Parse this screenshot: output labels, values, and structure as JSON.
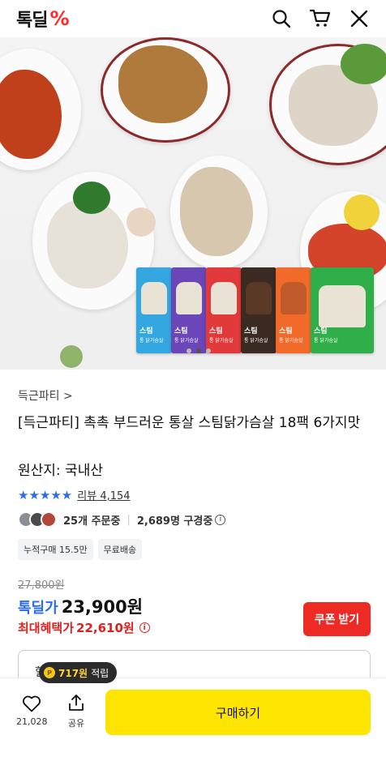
{
  "header": {
    "logo_text": "톡딜",
    "logo_mark": "%",
    "icons": [
      "search-icon",
      "cart-icon",
      "close-icon"
    ]
  },
  "hero": {
    "pack_labels": [
      "스팀",
      "스팀",
      "스팀",
      "스팀",
      "스팀",
      "스팀"
    ],
    "pack_sublabels": [
      "통 닭가슴살",
      "통 닭가슴살",
      "통 닭가슴살",
      "통 닭가슴살",
      "통 닭가슴살",
      "통 닭가슴살"
    ],
    "pack_colors": [
      "#35a7e0",
      "#6b46b8",
      "#e23a3a",
      "#3a2a22",
      "#f26a2a",
      "#2fae4a"
    ],
    "carousel_dots": 3,
    "active_dot": 1
  },
  "product": {
    "brand_link": "득근파티 >",
    "title": "[득근파티] 촉촉 부드러운 통살 스팀닭가슴살 18팩 6가지맛",
    "origin": "원산지: 국내산",
    "stars": "★★★★★",
    "review_label": "리뷰",
    "review_count": "4,154",
    "orders_text": "25개 주문중",
    "viewers_text": "2,689명 구경중",
    "tags": [
      "누적구매 15.5만",
      "무료배송"
    ]
  },
  "price": {
    "original": "27,800원",
    "sale_label": "톡딜가",
    "sale_price": "23,900원",
    "benefit_label": "최대혜택가",
    "benefit_price": "22,610원",
    "coupon_button": "쿠폰 받기"
  },
  "points": {
    "amount": "717원",
    "suffix": "적립"
  },
  "box_peek_text": "할",
  "bottom_bar": {
    "like_count": "21,028",
    "share_label": "공유",
    "buy_button": "구매하기"
  }
}
